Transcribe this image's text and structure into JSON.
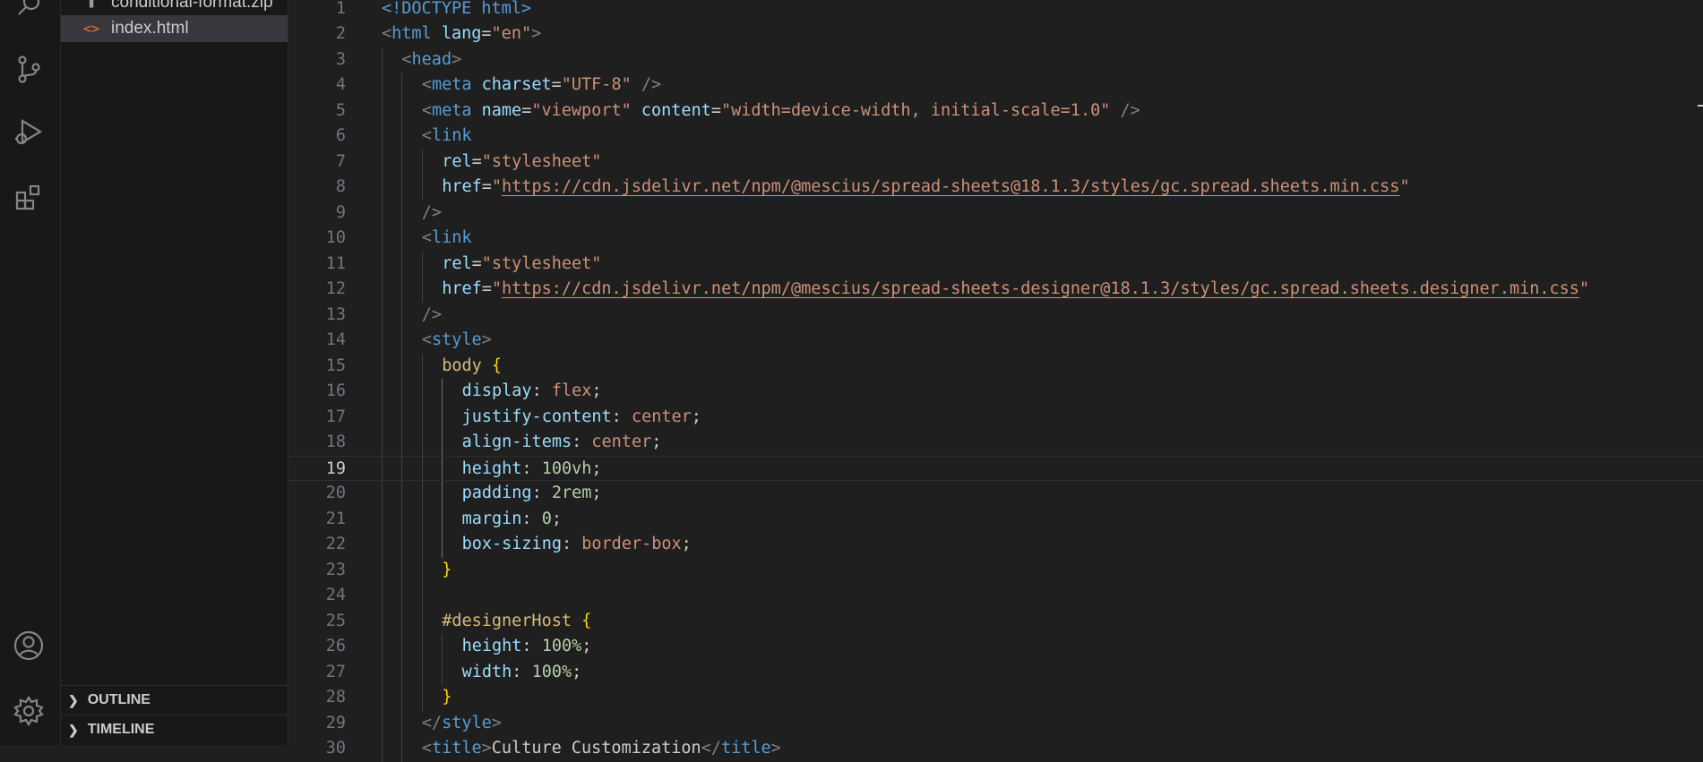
{
  "sidebar": {
    "files": [
      {
        "name": "conditional-format.zip",
        "icon": "zip-file-icon",
        "active": false
      },
      {
        "name": "index.html",
        "icon": "html-file-icon",
        "active": true
      }
    ],
    "sections": [
      {
        "label": "OUTLINE"
      },
      {
        "label": "TIMELINE"
      }
    ]
  },
  "editor": {
    "current_line": 19,
    "lines": [
      {
        "n": "1",
        "indent": 0,
        "tokens": [
          [
            "tag",
            "<!DOCTYPE html>"
          ]
        ]
      },
      {
        "n": "2",
        "indent": 0,
        "tokens": [
          [
            "punct",
            "<"
          ],
          [
            "tag",
            "html"
          ],
          [
            "text",
            " "
          ],
          [
            "attr",
            "lang"
          ],
          [
            "text",
            "="
          ],
          [
            "str",
            "\"en\""
          ],
          [
            "punct",
            ">"
          ]
        ]
      },
      {
        "n": "3",
        "indent": 1,
        "tokens": [
          [
            "punct",
            "<"
          ],
          [
            "tag",
            "head"
          ],
          [
            "punct",
            ">"
          ]
        ]
      },
      {
        "n": "4",
        "indent": 2,
        "tokens": [
          [
            "punct",
            "<"
          ],
          [
            "tag",
            "meta"
          ],
          [
            "text",
            " "
          ],
          [
            "attr",
            "charset"
          ],
          [
            "text",
            "="
          ],
          [
            "str",
            "\"UTF-8\""
          ],
          [
            "text",
            " "
          ],
          [
            "punct",
            "/>"
          ]
        ]
      },
      {
        "n": "5",
        "indent": 2,
        "tokens": [
          [
            "punct",
            "<"
          ],
          [
            "tag",
            "meta"
          ],
          [
            "text",
            " "
          ],
          [
            "attr",
            "name"
          ],
          [
            "text",
            "="
          ],
          [
            "str",
            "\"viewport\""
          ],
          [
            "text",
            " "
          ],
          [
            "attr",
            "content"
          ],
          [
            "text",
            "="
          ],
          [
            "str",
            "\"width=device-width, initial-scale=1.0\""
          ],
          [
            "text",
            " "
          ],
          [
            "punct",
            "/>"
          ]
        ]
      },
      {
        "n": "6",
        "indent": 2,
        "tokens": [
          [
            "punct",
            "<"
          ],
          [
            "tag",
            "link"
          ]
        ]
      },
      {
        "n": "7",
        "indent": 3,
        "tokens": [
          [
            "attr",
            "rel"
          ],
          [
            "text",
            "="
          ],
          [
            "str",
            "\"stylesheet\""
          ]
        ]
      },
      {
        "n": "8",
        "indent": 3,
        "tokens": [
          [
            "attr",
            "href"
          ],
          [
            "text",
            "="
          ],
          [
            "str",
            "\""
          ],
          [
            "link",
            "https://cdn.jsdelivr.net/npm/@mescius/spread-sheets@18.1.3/styles/gc.spread.sheets.min.css"
          ],
          [
            "str",
            "\""
          ]
        ]
      },
      {
        "n": "9",
        "indent": 2,
        "tokens": [
          [
            "punct",
            "/>"
          ]
        ]
      },
      {
        "n": "10",
        "indent": 2,
        "tokens": [
          [
            "punct",
            "<"
          ],
          [
            "tag",
            "link"
          ]
        ]
      },
      {
        "n": "11",
        "indent": 3,
        "tokens": [
          [
            "attr",
            "rel"
          ],
          [
            "text",
            "="
          ],
          [
            "str",
            "\"stylesheet\""
          ]
        ]
      },
      {
        "n": "12",
        "indent": 3,
        "tokens": [
          [
            "attr",
            "href"
          ],
          [
            "text",
            "="
          ],
          [
            "str",
            "\""
          ],
          [
            "link",
            "https://cdn.jsdelivr.net/npm/@mescius/spread-sheets-designer@18.1.3/styles/gc.spread.sheets.designer.min.css"
          ],
          [
            "str",
            "\""
          ]
        ]
      },
      {
        "n": "13",
        "indent": 2,
        "tokens": [
          [
            "punct",
            "/>"
          ]
        ]
      },
      {
        "n": "14",
        "indent": 2,
        "tokens": [
          [
            "punct",
            "<"
          ],
          [
            "tag",
            "style"
          ],
          [
            "punct",
            ">"
          ]
        ]
      },
      {
        "n": "15",
        "indent": 3,
        "tokens": [
          [
            "sel",
            "body"
          ],
          [
            "text",
            " "
          ],
          [
            "brace",
            "{"
          ]
        ]
      },
      {
        "n": "16",
        "indent": 4,
        "tokens": [
          [
            "prop",
            "display"
          ],
          [
            "text",
            ": "
          ],
          [
            "val",
            "flex"
          ],
          [
            "text",
            ";"
          ]
        ]
      },
      {
        "n": "17",
        "indent": 4,
        "tokens": [
          [
            "prop",
            "justify-content"
          ],
          [
            "text",
            ": "
          ],
          [
            "val",
            "center"
          ],
          [
            "text",
            ";"
          ]
        ]
      },
      {
        "n": "18",
        "indent": 4,
        "tokens": [
          [
            "prop",
            "align-items"
          ],
          [
            "text",
            ": "
          ],
          [
            "val",
            "center"
          ],
          [
            "text",
            ";"
          ]
        ]
      },
      {
        "n": "19",
        "indent": 4,
        "tokens": [
          [
            "prop",
            "height"
          ],
          [
            "text",
            ": "
          ],
          [
            "num",
            "100vh"
          ],
          [
            "text",
            ";"
          ]
        ]
      },
      {
        "n": "20",
        "indent": 4,
        "tokens": [
          [
            "prop",
            "padding"
          ],
          [
            "text",
            ": "
          ],
          [
            "num",
            "2rem"
          ],
          [
            "text",
            ";"
          ]
        ]
      },
      {
        "n": "21",
        "indent": 4,
        "tokens": [
          [
            "prop",
            "margin"
          ],
          [
            "text",
            ": "
          ],
          [
            "num",
            "0"
          ],
          [
            "text",
            ";"
          ]
        ]
      },
      {
        "n": "22",
        "indent": 4,
        "tokens": [
          [
            "prop",
            "box-sizing"
          ],
          [
            "text",
            ": "
          ],
          [
            "val",
            "border-box"
          ],
          [
            "text",
            ";"
          ]
        ]
      },
      {
        "n": "23",
        "indent": 3,
        "tokens": [
          [
            "brace",
            "}"
          ]
        ]
      },
      {
        "n": "24",
        "indent": 3,
        "tokens": []
      },
      {
        "n": "25",
        "indent": 3,
        "tokens": [
          [
            "sel",
            "#designerHost"
          ],
          [
            "text",
            " "
          ],
          [
            "brace",
            "{"
          ]
        ]
      },
      {
        "n": "26",
        "indent": 4,
        "tokens": [
          [
            "prop",
            "height"
          ],
          [
            "text",
            ": "
          ],
          [
            "num",
            "100%"
          ],
          [
            "text",
            ";"
          ]
        ]
      },
      {
        "n": "27",
        "indent": 4,
        "tokens": [
          [
            "prop",
            "width"
          ],
          [
            "text",
            ": "
          ],
          [
            "num",
            "100%"
          ],
          [
            "text",
            ";"
          ]
        ]
      },
      {
        "n": "28",
        "indent": 3,
        "tokens": [
          [
            "brace",
            "}"
          ]
        ]
      },
      {
        "n": "29",
        "indent": 2,
        "tokens": [
          [
            "punct",
            "</"
          ],
          [
            "tag",
            "style"
          ],
          [
            "punct",
            ">"
          ]
        ]
      },
      {
        "n": "30",
        "indent": 2,
        "tokens": [
          [
            "punct",
            "<"
          ],
          [
            "tag",
            "title"
          ],
          [
            "punct",
            ">"
          ],
          [
            "text",
            "Culture Customization"
          ],
          [
            "punct",
            "</"
          ],
          [
            "tag",
            "title"
          ],
          [
            "punct",
            ">"
          ]
        ]
      }
    ]
  }
}
